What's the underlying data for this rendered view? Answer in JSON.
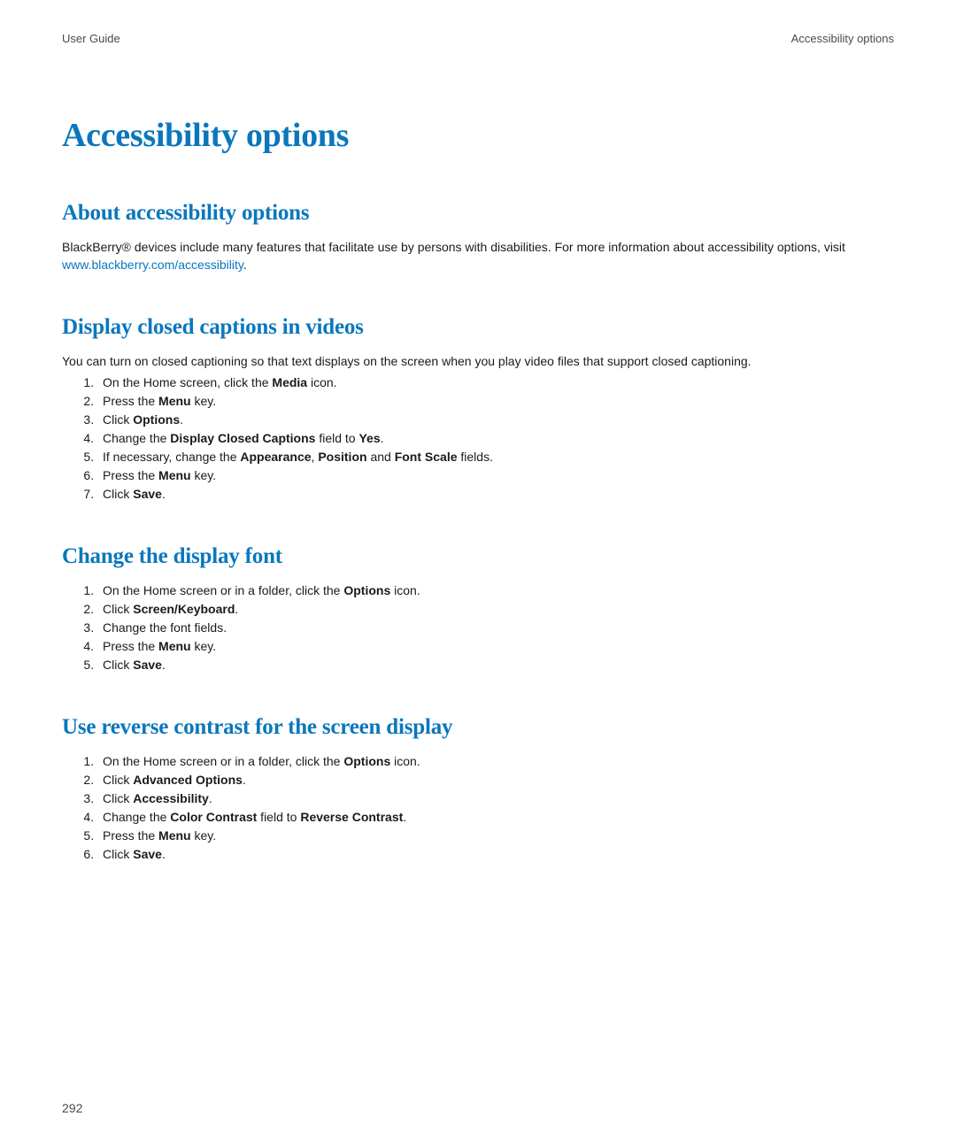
{
  "header": {
    "left": "User Guide",
    "right": "Accessibility options"
  },
  "title": "Accessibility options",
  "sections": {
    "about": {
      "heading": "About accessibility options",
      "para_pre": "BlackBerry® devices include many features that facilitate use by persons with disabilities. For more information about accessibility options, visit ",
      "link_text": "www.blackberry.com/accessibility",
      "para_post": "."
    },
    "captions": {
      "heading": "Display closed captions in videos",
      "intro": "You can turn on closed captioning so that text displays on the screen when you play video files that support closed captioning.",
      "steps": [
        {
          "pre": "On the Home screen, click the ",
          "b1": "Media",
          "mid": " icon.",
          "b2": "",
          "post": ""
        },
        {
          "pre": "Press the ",
          "b1": "Menu",
          "mid": " key.",
          "b2": "",
          "post": ""
        },
        {
          "pre": "Click ",
          "b1": "Options",
          "mid": ".",
          "b2": "",
          "post": ""
        },
        {
          "pre": "Change the ",
          "b1": "Display Closed Captions",
          "mid": " field to ",
          "b2": "Yes",
          "post": "."
        },
        {
          "pre": "If necessary, change the ",
          "b1": "Appearance",
          "mid": ", ",
          "b2": "Position",
          "post_mid": " and ",
          "b3": "Font Scale",
          "post": " fields."
        },
        {
          "pre": "Press the ",
          "b1": "Menu",
          "mid": " key.",
          "b2": "",
          "post": ""
        },
        {
          "pre": "Click ",
          "b1": "Save",
          "mid": ".",
          "b2": "",
          "post": ""
        }
      ]
    },
    "font": {
      "heading": "Change the display font",
      "steps": [
        {
          "pre": "On the Home screen or in a folder, click the ",
          "b1": "Options",
          "mid": " icon.",
          "b2": "",
          "post": ""
        },
        {
          "pre": "Click ",
          "b1": "Screen/Keyboard",
          "mid": ".",
          "b2": "",
          "post": ""
        },
        {
          "pre": "Change the font fields.",
          "b1": "",
          "mid": "",
          "b2": "",
          "post": ""
        },
        {
          "pre": "Press the ",
          "b1": "Menu",
          "mid": " key.",
          "b2": "",
          "post": ""
        },
        {
          "pre": "Click ",
          "b1": "Save",
          "mid": ".",
          "b2": "",
          "post": ""
        }
      ]
    },
    "contrast": {
      "heading": "Use reverse contrast for the screen display",
      "steps": [
        {
          "pre": "On the Home screen or in a folder, click the ",
          "b1": "Options",
          "mid": " icon.",
          "b2": "",
          "post": ""
        },
        {
          "pre": "Click ",
          "b1": "Advanced Options",
          "mid": ".",
          "b2": "",
          "post": ""
        },
        {
          "pre": "Click ",
          "b1": "Accessibility",
          "mid": ".",
          "b2": "",
          "post": ""
        },
        {
          "pre": "Change the ",
          "b1": "Color Contrast",
          "mid": " field to ",
          "b2": "Reverse Contrast",
          "post": "."
        },
        {
          "pre": "Press the ",
          "b1": "Menu",
          "mid": " key.",
          "b2": "",
          "post": ""
        },
        {
          "pre": "Click ",
          "b1": "Save",
          "mid": ".",
          "b2": "",
          "post": ""
        }
      ]
    }
  },
  "page_number": "292"
}
